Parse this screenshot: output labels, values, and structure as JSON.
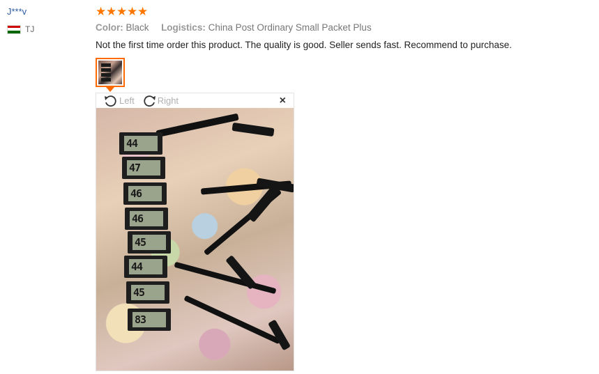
{
  "user": {
    "name": "J***v",
    "country_code": "TJ",
    "flag_colors": [
      "#cc0000",
      "#ffffff",
      "#006600"
    ]
  },
  "review": {
    "rating": 5,
    "stars": [
      "★",
      "★",
      "★",
      "★",
      "★"
    ],
    "star_color": "#ff7700",
    "color_key": "Color:",
    "color_value": "Black",
    "logistics_key": "Logistics:",
    "logistics_value": "China Post Ordinary Small Packet Plus",
    "text": "Not the first time order this product. The quality is good. Seller sends fast. Recommend to purchase."
  },
  "viewer": {
    "rotate_left_label": "Left",
    "rotate_right_label": "Right",
    "close_symbol": "×",
    "accent_color": "#ff6a00",
    "readings": [
      "44",
      "47",
      "46",
      "46",
      "45",
      "44",
      "45",
      "83"
    ]
  }
}
